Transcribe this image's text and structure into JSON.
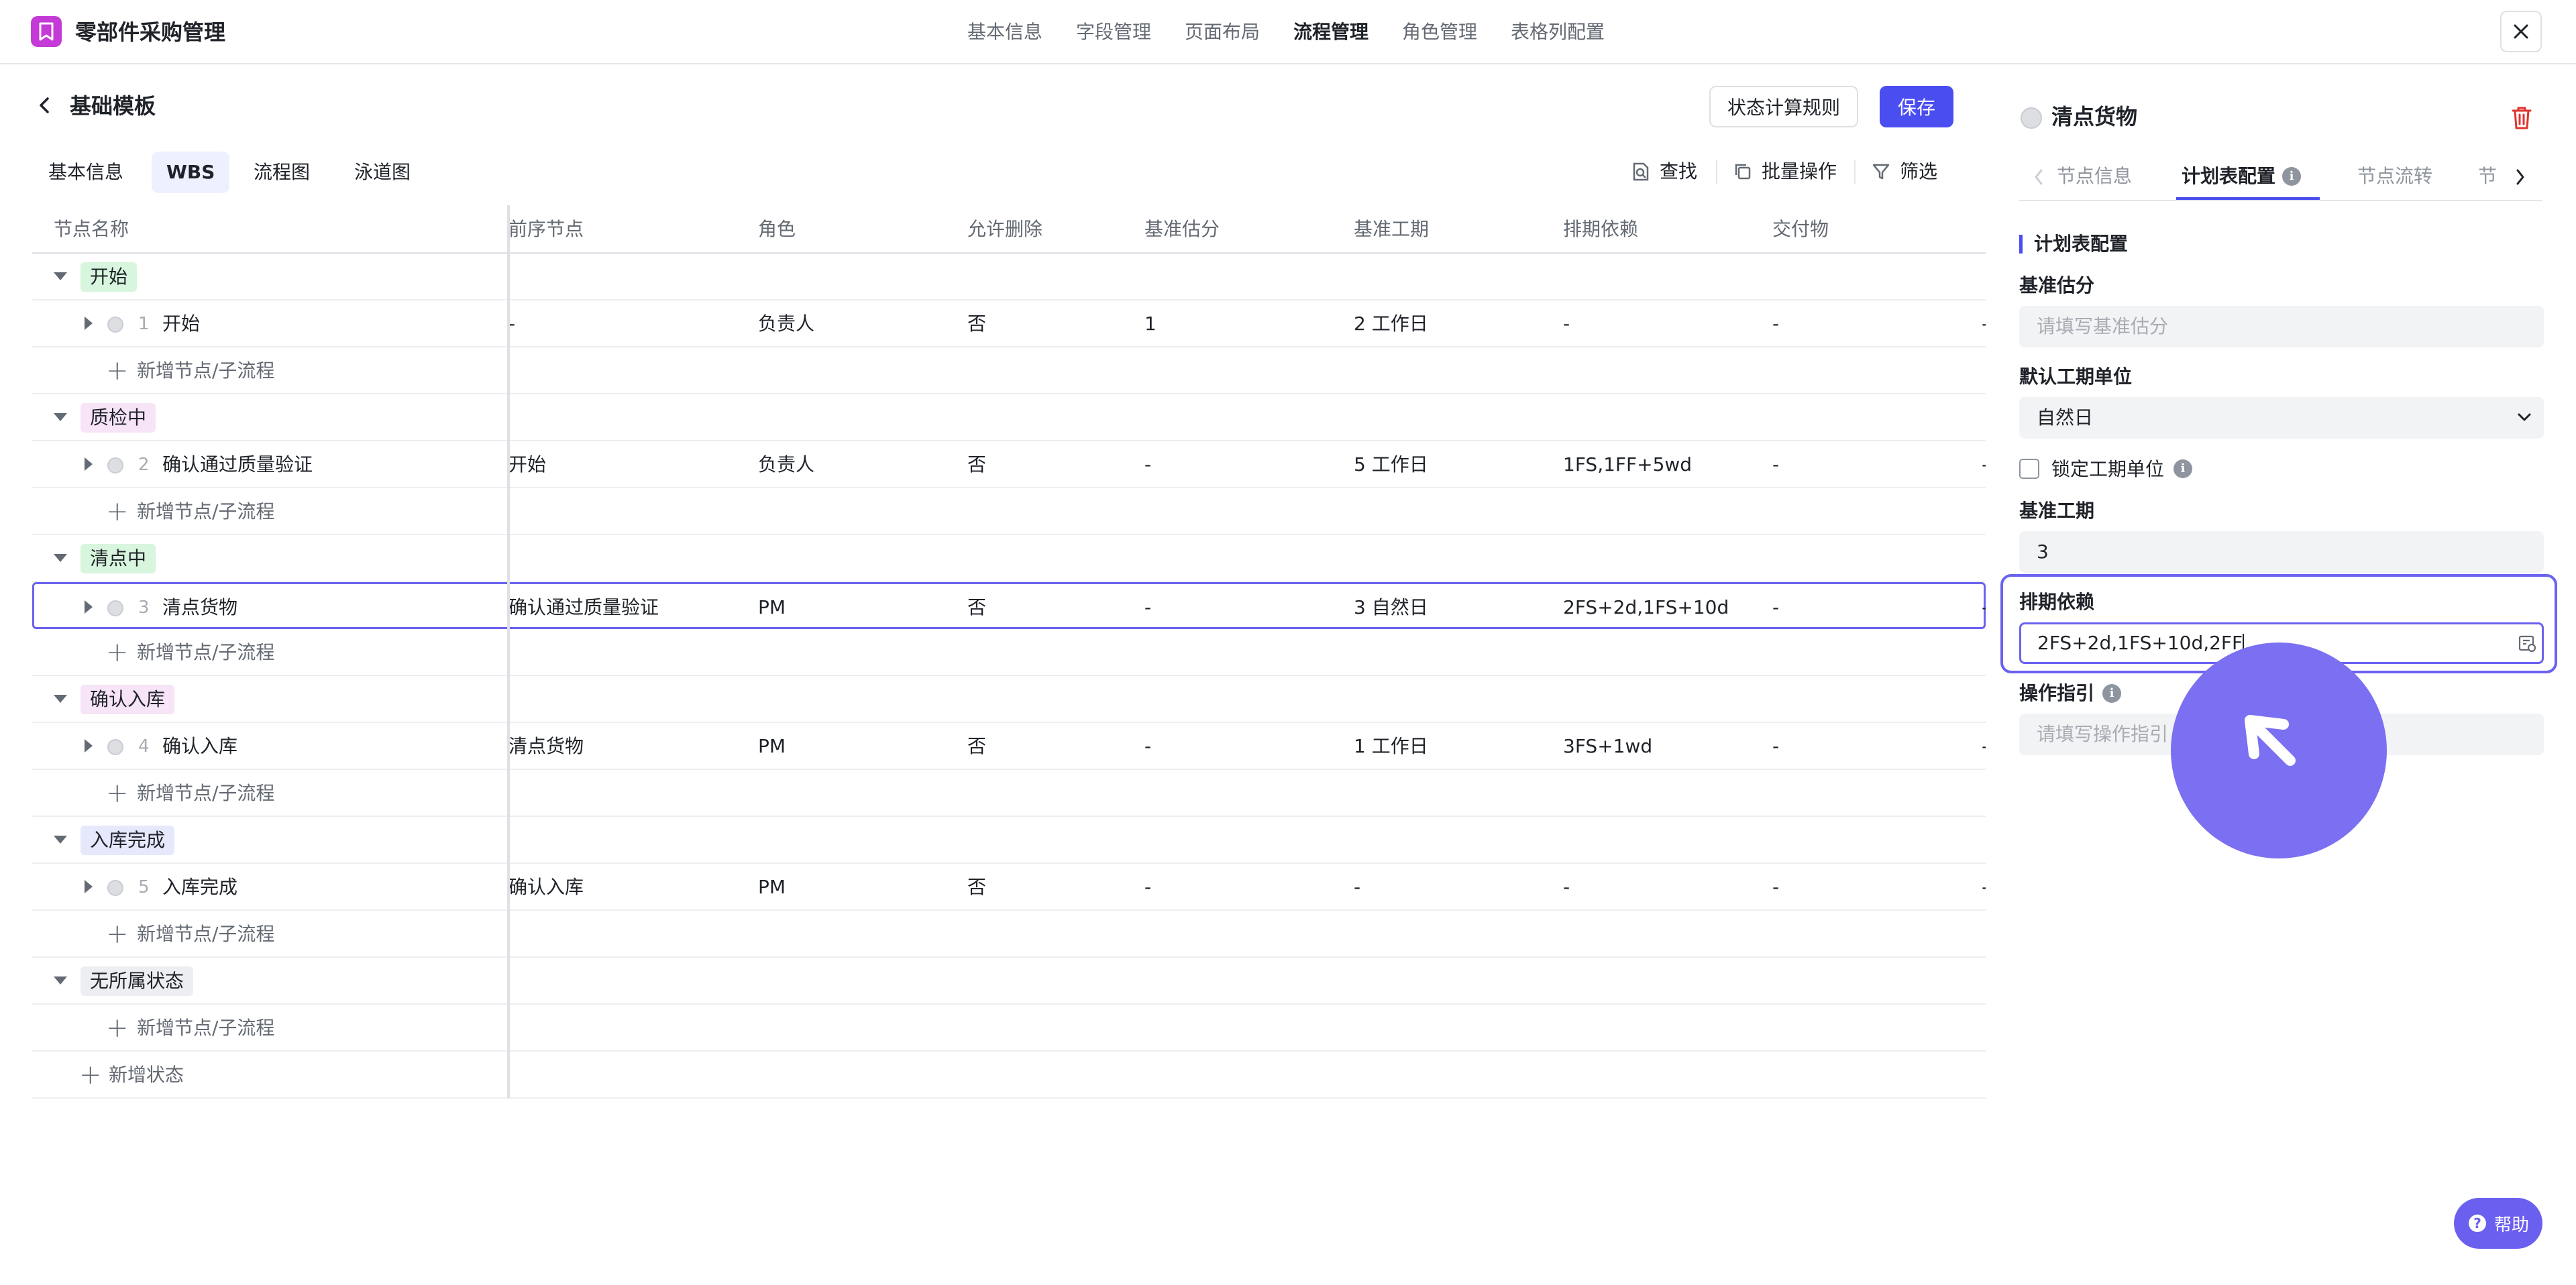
{
  "app": {
    "title": "零部件采购管理",
    "nav": [
      "基本信息",
      "字段管理",
      "页面布局",
      "流程管理",
      "角色管理",
      "表格列配置"
    ],
    "active_nav": "流程管理"
  },
  "header": {
    "title": "基础模板",
    "state_rule_button": "状态计算规则",
    "save_button": "保存"
  },
  "subtabs": [
    "基本信息",
    "WBS",
    "流程图",
    "泳道图"
  ],
  "active_subtab": "WBS",
  "toolbar": {
    "find": "查找",
    "batch": "批量操作",
    "filter": "筛选"
  },
  "table": {
    "columns": [
      "节点名称",
      "前序节点",
      "角色",
      "允许删除",
      "基准估分",
      "基准工期",
      "排期依赖",
      "交付物"
    ],
    "add_node_label": "新增节点/子流程",
    "add_state_label": "新增状态",
    "groups": [
      {
        "status": "开始",
        "color": "#d8f5dd",
        "node": {
          "index": "1",
          "name": "开始",
          "predecessor": "-",
          "role": "负责人",
          "allow_delete": "否",
          "estimate": "1",
          "duration": "2 工作日",
          "dependency": "-",
          "deliverable": "-",
          "extra": "-"
        }
      },
      {
        "status": "质检中",
        "color": "#f7e4f6",
        "node": {
          "index": "2",
          "name": "确认通过质量验证",
          "predecessor": "开始",
          "role": "负责人",
          "allow_delete": "否",
          "estimate": "-",
          "duration": "5 工作日",
          "dependency": "1FS,1FF+5wd",
          "deliverable": "-",
          "extra": "-"
        }
      },
      {
        "status": "清点中",
        "color": "#d8f5dd",
        "node": {
          "index": "3",
          "name": "清点货物",
          "predecessor": "确认通过质量验证",
          "role": "PM",
          "allow_delete": "否",
          "estimate": "-",
          "duration": "3 自然日",
          "dependency": "2FS+2d,1FS+10d...",
          "deliverable": "-",
          "extra": "-"
        }
      },
      {
        "status": "确认入库",
        "color": "#f7e4f6",
        "node": {
          "index": "4",
          "name": "确认入库",
          "predecessor": "清点货物",
          "role": "PM",
          "allow_delete": "否",
          "estimate": "-",
          "duration": "1 工作日",
          "dependency": "3FS+1wd",
          "deliverable": "-",
          "extra": "-"
        }
      },
      {
        "status": "入库完成",
        "color": "#e6e8fc",
        "node": {
          "index": "5",
          "name": "入库完成",
          "predecessor": "确认入库",
          "role": "PM",
          "allow_delete": "否",
          "estimate": "-",
          "duration": "-",
          "dependency": "-",
          "deliverable": "-",
          "extra": "-"
        }
      },
      {
        "status": "无所属状态",
        "color": "#eceef1",
        "node": null
      }
    ]
  },
  "panel": {
    "title": "清点货物",
    "tabs": [
      "节点信息",
      "计划表配置",
      "节点流转",
      "节"
    ],
    "active_tab": "计划表配置",
    "section_title": "计划表配置",
    "estimate": {
      "label": "基准估分",
      "placeholder": "请填写基准估分"
    },
    "unit": {
      "label": "默认工期单位",
      "value": "自然日"
    },
    "lock_unit": {
      "label": "锁定工期单位"
    },
    "duration": {
      "label": "基准工期",
      "value": "3"
    },
    "dependency": {
      "label": "排期依赖",
      "value": "2FS+2d,1FS+10d,2FF"
    },
    "guide": {
      "label": "操作指引",
      "placeholder": "请填写操作指引"
    }
  },
  "help_button": "帮助",
  "colors": {
    "primary": "#4a4df0",
    "focus": "#6b62f0",
    "cursor": "#7b6ff2",
    "app_icon": "#c43ad6",
    "delete": "#e0332f"
  }
}
